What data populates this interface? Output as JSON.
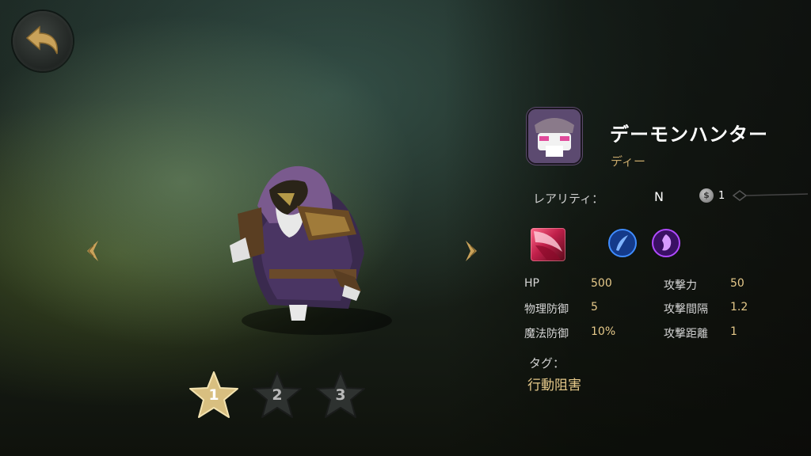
{
  "hero": {
    "name": "デーモンハンター",
    "subtitle": "ディー",
    "rarity_label": "レアリティ：",
    "rarity_value": "N",
    "coin_symbol": "$",
    "coin_count": "1"
  },
  "stars": [
    {
      "label": "1",
      "active": true
    },
    {
      "label": "2",
      "active": false
    },
    {
      "label": "3",
      "active": false
    }
  ],
  "stats": [
    {
      "label1": "HP",
      "value1": "500",
      "label2": "攻撃力",
      "value2": "50"
    },
    {
      "label1": "物理防御",
      "value1": "5",
      "label2": "攻撃間隔",
      "value2": "1.2"
    },
    {
      "label1": "魔法防御",
      "value1": "10%",
      "label2": "攻撃距離",
      "value2": "1"
    }
  ],
  "tags": {
    "label": "タグ：",
    "value": "行動阻害"
  },
  "skills": [
    {
      "icon": "red-slash-skill-icon",
      "color": "#c0204a"
    },
    {
      "icon": "blue-feather-skill-icon",
      "color": "#2a6fd6"
    },
    {
      "icon": "purple-spirit-skill-icon",
      "color": "#8a2ad6"
    }
  ],
  "colors": {
    "accent_gold": "#c7a86a",
    "stat_value": "#e6c98a"
  }
}
